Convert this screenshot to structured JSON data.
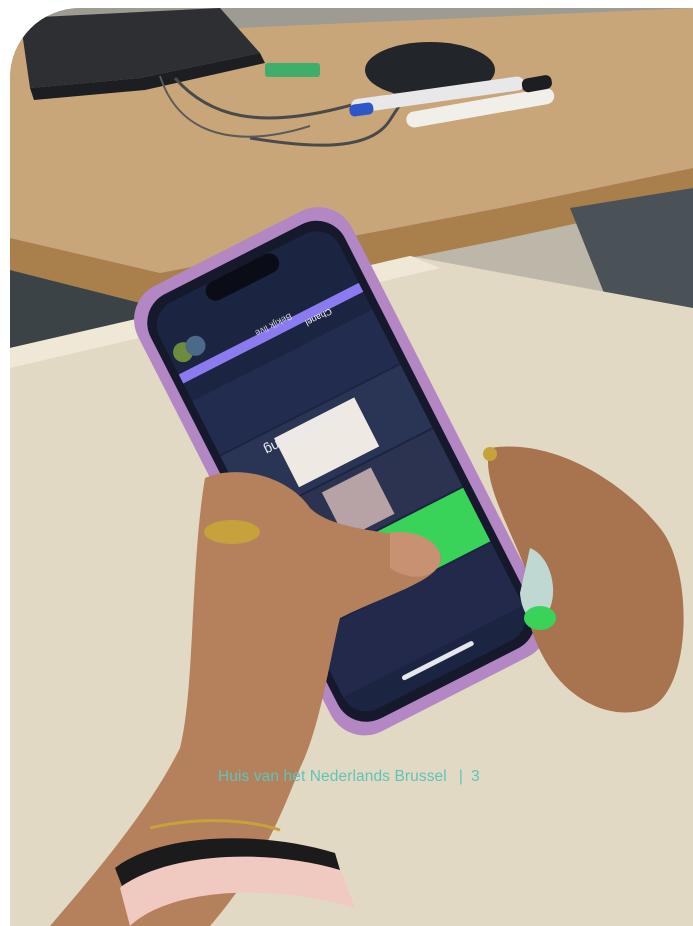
{
  "photo": {
    "subject": "hands-holding-smartphone-with-quiz-app",
    "colors": {
      "table_top": "#c9a679",
      "table_edge": "#a97f4c",
      "desk": "#e2d9c4",
      "phone_case": "#b386c4",
      "screen": "#1b2440",
      "quiz_header": "#8a7cf0",
      "answer_green": "#39d35a",
      "skin": "#b5805c"
    }
  },
  "phone_screen": {
    "title": "meubelzaking",
    "player_label": "Chanel",
    "status_text": "Bekijk live"
  },
  "footer": {
    "organisation": "Huis van het Nederlands Brussel",
    "separator": "|",
    "page_number": "3"
  }
}
